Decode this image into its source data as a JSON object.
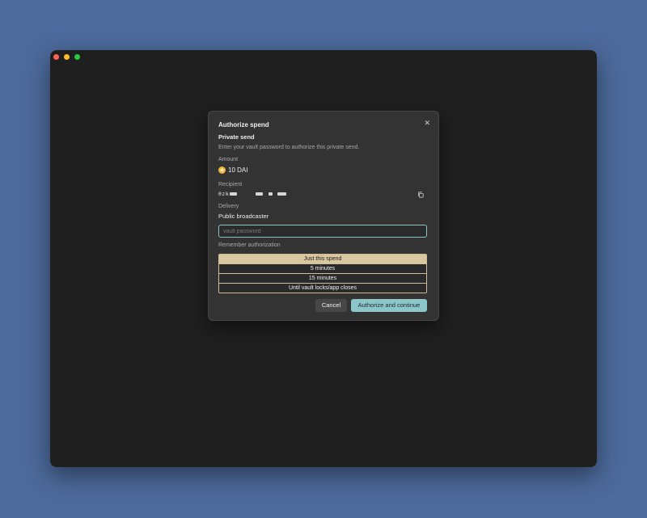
{
  "dialog": {
    "title": "Authorize spend",
    "subtitle": "Private send",
    "description": "Enter your vault password to authorize this private send.",
    "amount_label": "Amount",
    "amount_value": "10 DAI",
    "amount_icon": "dai-coin-icon",
    "recipient_label": "Recipient",
    "recipient_prefix": "0zk",
    "delivery_label": "Delivery",
    "delivery_value": "Public broadcaster",
    "password_placeholder": "vault password",
    "remember_label": "Remember authorization",
    "remember_options": [
      "Just this spend",
      "5 minutes",
      "15 minutes",
      "Until vault locks/app closes"
    ],
    "selected_option": "Just this spend",
    "cancel_label": "Cancel",
    "confirm_label": "Authorize and continue"
  },
  "colors": {
    "background": "#4c6a9b",
    "window": "#1f1f1f",
    "dialog": "#333333",
    "accent": "#8cc6c9",
    "selected_option": "#d9c7a0",
    "coin": "#f2b53a"
  }
}
